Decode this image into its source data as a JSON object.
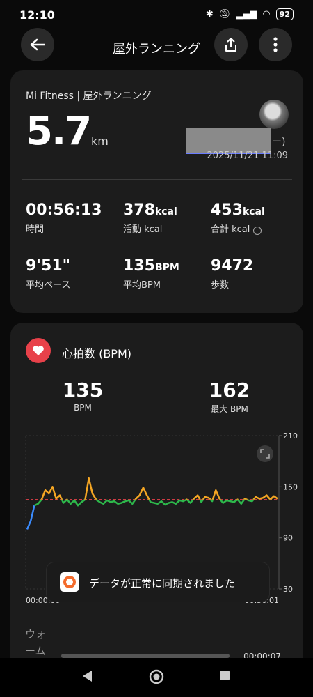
{
  "status_bar": {
    "time": "12:10",
    "battery": "92"
  },
  "header": {
    "title": "屋外ランニング"
  },
  "summary": {
    "subtitle": "Mi Fitness | 屋外ランニング",
    "distance": "5.7",
    "distance_unit": "km",
    "dash": "ー)",
    "datetime": "2025/11/21 11:09",
    "stats": [
      {
        "value": "00:56:13",
        "unit": "",
        "label": "時間"
      },
      {
        "value": "378",
        "unit": "kcal",
        "label": "活動 kcal"
      },
      {
        "value": "453",
        "unit": "kcal",
        "label": "合計 kcal"
      },
      {
        "value": "9'51\"",
        "unit": "",
        "label": "平均ペース"
      },
      {
        "value": "135",
        "unit": "BPM",
        "label": "平均BPM"
      },
      {
        "value": "9472",
        "unit": "",
        "label": "歩数"
      }
    ]
  },
  "heart_rate": {
    "title": "心拍数 (BPM)",
    "avg_value": "135",
    "avg_caption": "BPM",
    "max_value": "162",
    "max_caption": "最大 BPM"
  },
  "chart_data": {
    "type": "line",
    "y_ticks": [
      "210",
      "150",
      "90",
      "30"
    ],
    "ylim": [
      30,
      210
    ],
    "x_tick_start": "00:00:00",
    "x_tick_end": "00:56:01",
    "average_line": 135,
    "series": [
      {
        "values": [
          100,
          110,
          128,
          130,
          135,
          146,
          142,
          150,
          136,
          140,
          131,
          135,
          130,
          134,
          128,
          132,
          135,
          160,
          142,
          135,
          132,
          130,
          134,
          132,
          133,
          130,
          131,
          133,
          134,
          130,
          136,
          140,
          149,
          140,
          132,
          131,
          130,
          133,
          129,
          131,
          132,
          130,
          134,
          133,
          135,
          131,
          136,
          140,
          132,
          138,
          137,
          133,
          146,
          136,
          131,
          134,
          133,
          132,
          135,
          130,
          136,
          134,
          133,
          138,
          136,
          137,
          140,
          135,
          139,
          136
        ]
      }
    ]
  },
  "toast": {
    "text": "データが正常に同期されました"
  },
  "warmup": {
    "label": "ウォーム",
    "time": "00:00:07"
  },
  "colors": {
    "heart": "#e8414a",
    "line_above": "#f5a623",
    "line_below": "#2db84b",
    "avg_line": "#e8414a",
    "start_line": "#3b8cff"
  }
}
